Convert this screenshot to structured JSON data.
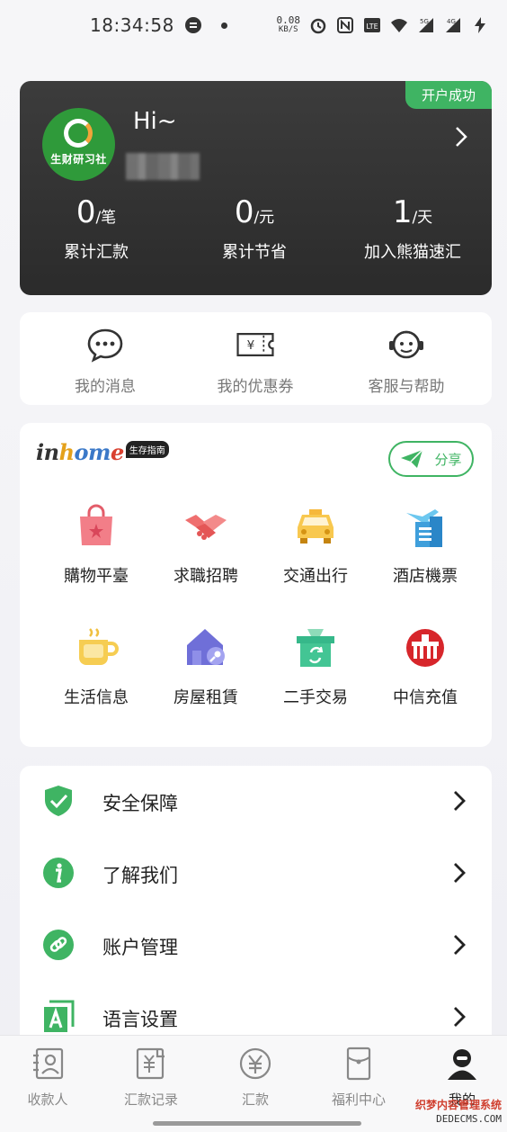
{
  "status_bar": {
    "time": "18:34:58",
    "speed_value": "0.08",
    "speed_unit": "KB/S",
    "network_1": "5G",
    "network_2": "4G"
  },
  "account": {
    "badge": "开户成功",
    "avatar_text": "生财研习社",
    "greeting": "Hi~",
    "stats": [
      {
        "value": "0",
        "unit": "/笔",
        "label": "累计汇款"
      },
      {
        "value": "0",
        "unit": "/元",
        "label": "累计节省"
      },
      {
        "value": "1",
        "unit": "/天",
        "label": "加入熊猫速汇"
      }
    ]
  },
  "quick_actions": [
    {
      "label": "我的消息",
      "icon": "message-icon"
    },
    {
      "label": "我的优惠券",
      "icon": "coupon-icon"
    },
    {
      "label": "客服与帮助",
      "icon": "customer-service-icon"
    }
  ],
  "inhome": {
    "logo": {
      "p1": "in",
      "p2": "h",
      "p3": "om",
      "p4": "e"
    },
    "tag": "生存指南",
    "share_label": "分享",
    "services": [
      {
        "label": "購物平臺",
        "icon": "shopping-bag-icon"
      },
      {
        "label": "求職招聘",
        "icon": "handshake-icon"
      },
      {
        "label": "交通出行",
        "icon": "taxi-icon"
      },
      {
        "label": "酒店機票",
        "icon": "hotel-plane-icon"
      },
      {
        "label": "生活信息",
        "icon": "coffee-cup-icon"
      },
      {
        "label": "房屋租賃",
        "icon": "house-key-icon"
      },
      {
        "label": "二手交易",
        "icon": "recycle-box-icon"
      },
      {
        "label": "中信充值",
        "icon": "citic-logo-icon"
      }
    ]
  },
  "menu": [
    {
      "label": "安全保障",
      "icon": "shield-check-icon"
    },
    {
      "label": "了解我们",
      "icon": "info-icon"
    },
    {
      "label": "账户管理",
      "icon": "link-icon"
    },
    {
      "label": "语言设置",
      "icon": "language-a-icon"
    }
  ],
  "bottom_nav": [
    {
      "label": "收款人",
      "icon": "contact-card-icon"
    },
    {
      "label": "汇款记录",
      "icon": "record-icon"
    },
    {
      "label": "汇款",
      "icon": "yen-icon"
    },
    {
      "label": "福利中心",
      "icon": "envelope-icon"
    },
    {
      "label": "我的",
      "icon": "profile-icon",
      "active": true
    }
  ],
  "watermark": {
    "line1": "织梦内容管理系统",
    "line2": "DEDECMS.COM"
  },
  "colors": {
    "accent_green": "#3fb463",
    "card_dark": "#333333",
    "menu_icon_green": "#3fb463"
  }
}
